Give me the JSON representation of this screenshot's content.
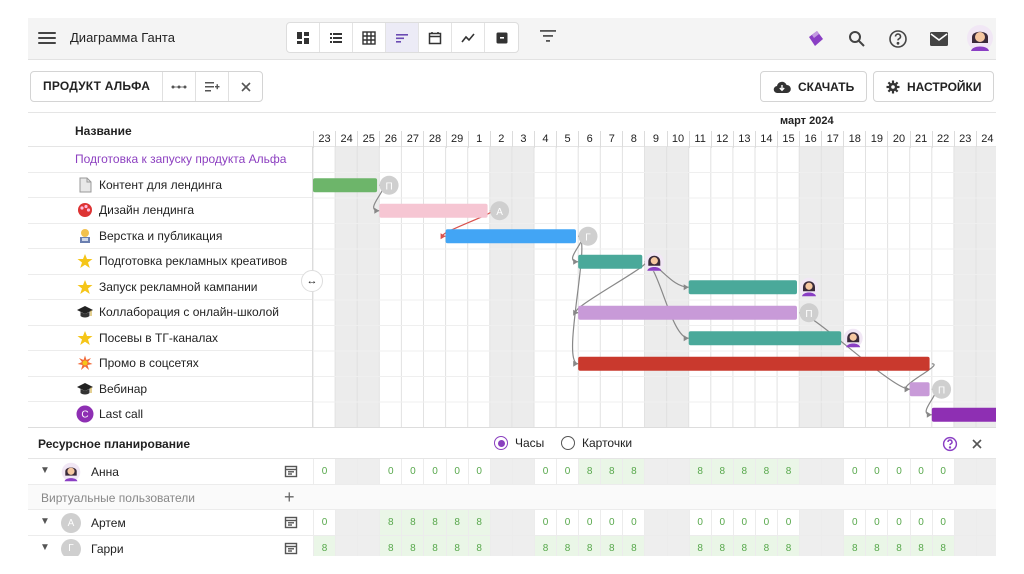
{
  "header": {
    "title": "Диаграмма Ганта",
    "views": [
      "board-icon",
      "list-icon",
      "table-icon",
      "gantt-icon",
      "calendar-icon",
      "chart-icon",
      "archive-icon"
    ],
    "active_view": 3
  },
  "toolbar": {
    "product": "ПРОДУКТ АЛЬФА",
    "download": "СКАЧАТЬ",
    "settings": "НАСТРОЙКИ"
  },
  "gantt": {
    "name_header": "Название",
    "month": "март 2024",
    "days": [
      "23",
      "24",
      "25",
      "26",
      "27",
      "28",
      "29",
      "1",
      "2",
      "3",
      "4",
      "5",
      "6",
      "7",
      "8",
      "9",
      "10",
      "11",
      "12",
      "13",
      "14",
      "15",
      "16",
      "17",
      "18",
      "19",
      "20",
      "21",
      "22",
      "23",
      "24"
    ],
    "weekend_columns": [
      1,
      2,
      8,
      9,
      15,
      16,
      22,
      23,
      29,
      30
    ],
    "group": "Подготовка к запуску продукта Альфа",
    "tasks": [
      {
        "label": "Контент для лендинга",
        "icon": "page-icon",
        "start": 0,
        "end": 2.9,
        "color": "#6db56a",
        "assignee": "П",
        "avatar": "gray"
      },
      {
        "label": "Дизайн лендинга",
        "icon": "artist-palette-icon",
        "start": 3,
        "end": 7.9,
        "color": "#f6c6d3",
        "assignee": "А",
        "avatar": "gray"
      },
      {
        "label": "Верстка и публикация",
        "icon": "technologist-icon",
        "start": 6,
        "end": 11.9,
        "color": "#42a5f5",
        "assignee": "Г",
        "avatar": "gray"
      },
      {
        "label": "Подготовка рекламных креативов",
        "icon": "star-icon",
        "start": 12,
        "end": 14.9,
        "color": "#4aa99a",
        "assignee": "",
        "avatar": "photo"
      },
      {
        "label": "Запуск рекламной кампании",
        "icon": "star-icon",
        "start": 17,
        "end": 21.9,
        "color": "#4aa99a",
        "assignee": "",
        "avatar": "photo"
      },
      {
        "label": "Коллаборация с онлайн-школой",
        "icon": "graduation-cap-icon",
        "start": 12,
        "end": 21.9,
        "color": "#c89ad8",
        "assignee": "П",
        "avatar": "gray"
      },
      {
        "label": "Посевы в ТГ-каналах",
        "icon": "star-icon",
        "start": 17,
        "end": 23.9,
        "color": "#4aa99a",
        "assignee": "",
        "avatar": "photo"
      },
      {
        "label": "Промо в соцсетях",
        "icon": "collision-icon",
        "start": 12,
        "end": 27.9,
        "color": "#c9392d",
        "assignee": "",
        "avatar": ""
      },
      {
        "label": "Вебинар",
        "icon": "graduation-cap-icon",
        "start": 27,
        "end": 27.9,
        "color": "#c89ad8",
        "assignee": "П",
        "avatar": "gray"
      },
      {
        "label": "Last call",
        "icon": "c-avatar-icon",
        "start": 28,
        "end": 31,
        "color": "#8e2fb3",
        "assignee": "",
        "avatar": ""
      }
    ]
  },
  "resources": {
    "title": "Ресурсное планирование",
    "option_hours": "Часы",
    "option_cards": "Карточки",
    "virtual_users": "Виртуальные пользователи",
    "people": [
      {
        "name": "Анна",
        "initial": "",
        "avatar": "photo",
        "values": [
          "0",
          "",
          "",
          "0",
          "0",
          "0",
          "0",
          "0",
          "",
          "",
          "0",
          "0",
          "8",
          "8",
          "8",
          "",
          "",
          "8",
          "8",
          "8",
          "8",
          "8",
          "",
          "",
          "0",
          "0",
          "0",
          "0",
          "0",
          "",
          ""
        ]
      },
      {
        "name": "Артем",
        "initial": "А",
        "avatar": "gray",
        "values": [
          "0",
          "",
          "",
          "8",
          "8",
          "8",
          "8",
          "8",
          "",
          "",
          "0",
          "0",
          "0",
          "0",
          "0",
          "",
          "",
          "0",
          "0",
          "0",
          "0",
          "0",
          "",
          "",
          "0",
          "0",
          "0",
          "0",
          "0",
          "",
          ""
        ]
      },
      {
        "name": "Гарри",
        "initial": "Г",
        "avatar": "gray",
        "values": [
          "8",
          "",
          "",
          "8",
          "8",
          "8",
          "8",
          "8",
          "",
          "",
          "8",
          "8",
          "8",
          "8",
          "8",
          "",
          "",
          "8",
          "8",
          "8",
          "8",
          "8",
          "",
          "",
          "8",
          "8",
          "8",
          "8",
          "8",
          "",
          ""
        ]
      }
    ]
  }
}
